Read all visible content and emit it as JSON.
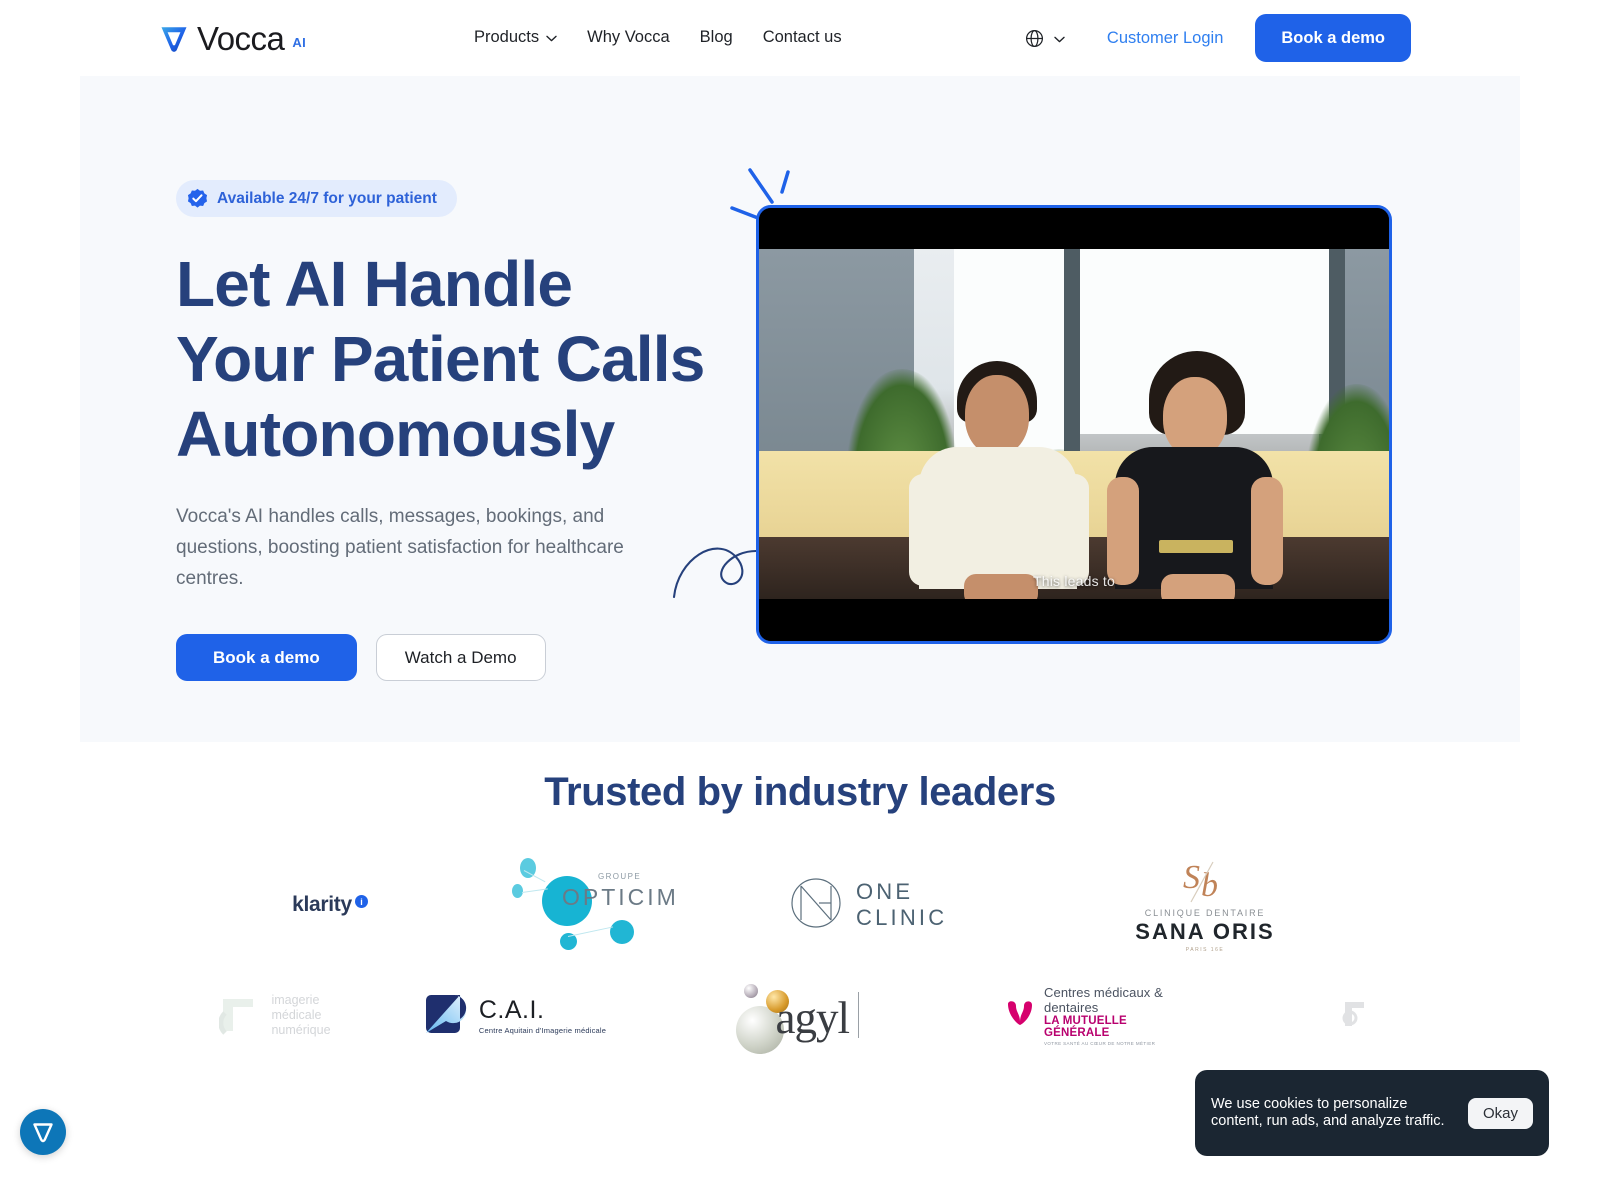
{
  "header": {
    "logo": {
      "word": "Vocca",
      "suffix": "AI",
      "icon": "vocca-v-logo-icon"
    },
    "nav": [
      {
        "label": "Products",
        "has_dropdown": true,
        "icon": "chevron-down-icon"
      },
      {
        "label": "Why Vocca",
        "has_dropdown": false
      },
      {
        "label": "Blog",
        "has_dropdown": false
      },
      {
        "label": "Contact us",
        "has_dropdown": false
      }
    ],
    "language_icon": "globe-icon",
    "language_chevron": "chevron-down-icon",
    "customer_login": "Customer Login",
    "book_demo": "Book a demo"
  },
  "hero": {
    "badge": {
      "text": "Available 24/7 for your patient",
      "icon": "verified-check-icon"
    },
    "title_lines": [
      "Let AI Handle",
      "Your Patient Calls",
      "Autonomously"
    ],
    "title": "Let AI Handle Your Patient Calls Autonomously",
    "subtitle": "Vocca's AI handles calls, messages, bookings, and questions, boosting patient satisfaction for healthcare centres.",
    "cta_primary": "Book a demo",
    "cta_secondary": "Watch a Demo",
    "video": {
      "caption": "This leads to",
      "alt": "Two men seated on a yellow couch in front of windows and plants"
    }
  },
  "trusted": {
    "title": "Trusted by industry leaders",
    "logos": [
      {
        "name": "klarity",
        "text": "klarity",
        "badge": "i"
      },
      {
        "name": "groupe-opticim",
        "text": "OPTICIM",
        "eyebrow": "GROUPE"
      },
      {
        "name": "one-clinic",
        "text": "ONE CLINIC"
      },
      {
        "name": "sana-oris",
        "monogram": "SO",
        "eyebrow": "CLINIQUE DENTAIRE",
        "text": "SANA ORIS",
        "footnote": "PARIS 16E"
      },
      {
        "name": "imagerie-medicale-numerique",
        "line1": "imagerie",
        "line2": "médicale",
        "line3": "numérique"
      },
      {
        "name": "cai",
        "text": "C.A.I.",
        "subtitle": "Centre Aquitain d'Imagerie médicale"
      },
      {
        "name": "agyl",
        "text": "agyl"
      },
      {
        "name": "la-mutuelle-generale",
        "line1": "Centres médicaux & dentaires",
        "line2": "LA MUTUELLE GÉNÉRALE",
        "line3": "VOTRE SANTÉ AU CŒUR DE NOTRE MÉTIER"
      },
      {
        "name": "partner-logo-faded",
        "text": ""
      }
    ]
  },
  "cookie_banner": {
    "text": "We use cookies to personalize content, run ads, and analyze traffic.",
    "accept_label": "Okay"
  },
  "chat_widget": {
    "icon": "vocca-chat-icon"
  },
  "colors": {
    "brand_blue": "#1f62e8",
    "link_blue": "#2f7ff0",
    "heading_navy": "#26417c",
    "hero_bg": "#f7f9fc",
    "cookie_bg": "#1b2632",
    "chat_bg": "#0d76b8"
  }
}
